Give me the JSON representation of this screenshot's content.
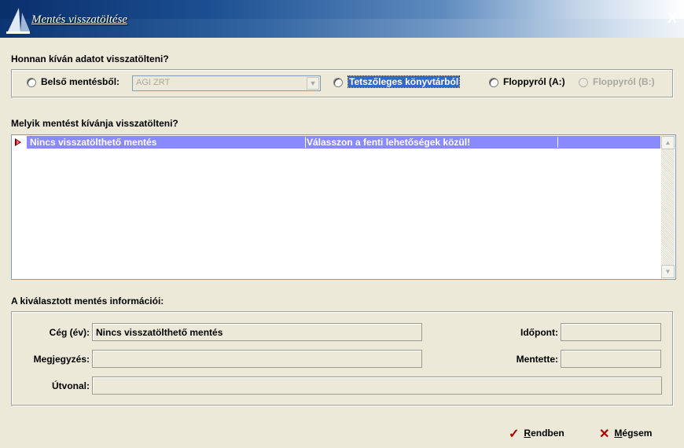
{
  "window": {
    "title": "Mentés visszatöltése",
    "close_label": "X"
  },
  "source": {
    "heading": "Honnan kíván adatot visszatölteni?",
    "internal_label": "Belső mentésből:",
    "internal_value": "AGI ZRT",
    "directory_label": "Tetszőleges könyvtárból",
    "floppy_a_label": "Floppyról (A:)",
    "floppy_b_label": "Floppyról (B:)"
  },
  "backups": {
    "heading": "Melyik mentést kívánja visszatölteni?",
    "rows": [
      {
        "name": "Nincs visszatölthető mentés",
        "note": "Válasszon a fenti lehetőségek közül!"
      }
    ]
  },
  "info": {
    "heading": "A kiválasztott mentés információi:",
    "company_label": "Cég (év):",
    "company_value": "Nincs visszatölthető mentés",
    "note_label": "Megjegyzés:",
    "note_value": "",
    "path_label": "Útvonal:",
    "path_value": "",
    "time_label": "Időpont:",
    "time_value": "",
    "saved_by_label": "Mentette:",
    "saved_by_value": ""
  },
  "footer": {
    "ok_first": "R",
    "ok_rest": "endben",
    "cancel_first": "M",
    "cancel_rest": "égsem"
  },
  "colors": {
    "selection": "#8a8aff",
    "focus": "#316ac5",
    "ok_icon": "#b00000",
    "cancel_icon": "#b00000"
  }
}
